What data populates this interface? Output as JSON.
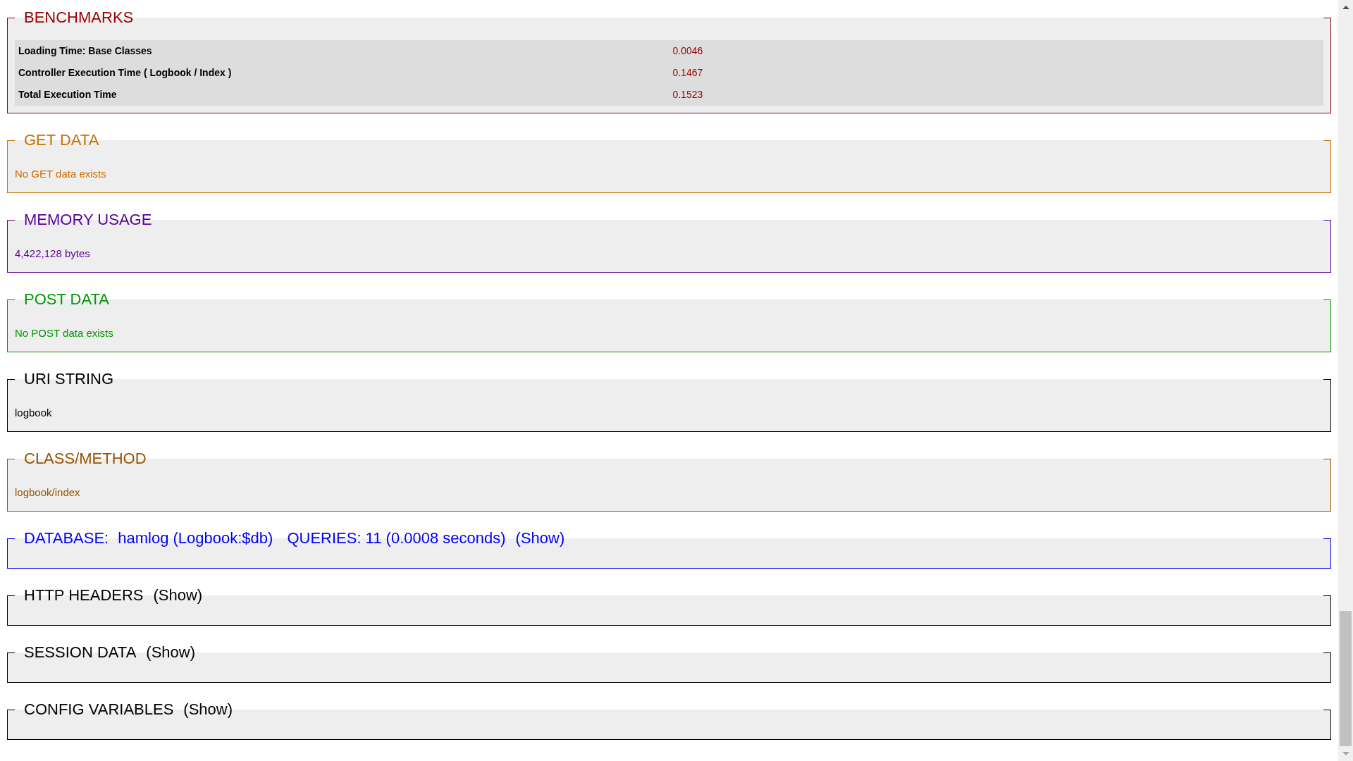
{
  "sections": [
    {
      "kind": "table",
      "title": "BENCHMARKS",
      "color": "#990000",
      "rows": [
        {
          "label": "Loading Time: Base Classes",
          "value": "0.0046"
        },
        {
          "label": "Controller Execution Time ( Logbook / Index )",
          "value": "0.1467"
        },
        {
          "label": "Total Execution Time",
          "value": "0.1523"
        }
      ]
    },
    {
      "kind": "message",
      "title": "GET DATA",
      "color": "#cd6e00",
      "text": "No GET data exists"
    },
    {
      "kind": "message",
      "title": "MEMORY USAGE",
      "color": "#5a0099",
      "text": "4,422,128 bytes"
    },
    {
      "kind": "message",
      "title": "POST DATA",
      "color": "#009900",
      "text": "No POST data exists"
    },
    {
      "kind": "message",
      "title": "URI STRING",
      "color": "#000000",
      "text": "logbook"
    },
    {
      "kind": "message",
      "title": "CLASS/METHOD",
      "color": "#995300",
      "text": "logbook/index"
    },
    {
      "kind": "collapsible",
      "title": "DATABASE:",
      "color": "#0000ff",
      "details": [
        "hamlog (Logbook:$db)",
        "QUERIES: 11 (0.0008 seconds)"
      ],
      "toggle": "(Show)"
    },
    {
      "kind": "collapsible",
      "title": "HTTP HEADERS",
      "color": "#000000",
      "toggle": "(Show)"
    },
    {
      "kind": "collapsible",
      "title": "SESSION DATA",
      "color": "#000000",
      "toggle": "(Show)"
    },
    {
      "kind": "collapsible",
      "title": "CONFIG VARIABLES",
      "color": "#000000",
      "toggle": "(Show)"
    }
  ]
}
